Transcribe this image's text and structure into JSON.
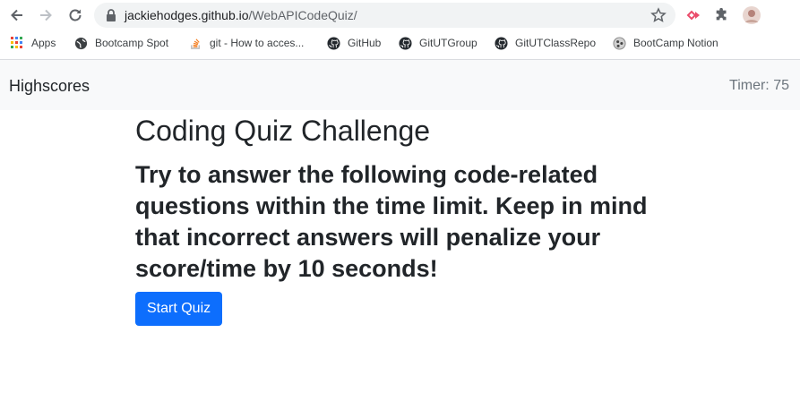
{
  "browser": {
    "url_host": "jackiehodges.github.io",
    "url_path": "/WebAPICodeQuiz/",
    "bookmarks": [
      {
        "label": "Apps",
        "icon": "apps-grid-icon"
      },
      {
        "label": "Bootcamp Spot",
        "icon": "globe-icon"
      },
      {
        "label": "git - How to acces...",
        "icon": "stackoverflow-icon"
      },
      {
        "label": "GitHub",
        "icon": "github-icon"
      },
      {
        "label": "GitUTGroup",
        "icon": "github-icon"
      },
      {
        "label": "GitUTClassRepo",
        "icon": "github-icon"
      },
      {
        "label": "BootCamp Notion",
        "icon": "notion-icon"
      }
    ]
  },
  "header": {
    "highscores_label": "Highscores",
    "timer_text": "Timer: 75"
  },
  "main": {
    "title": "Coding Quiz Challenge",
    "instructions": "Try to answer the following code-related questions within the time limit. Keep in mind that incorrect answers will penalize your score/time by 10 seconds!",
    "start_button_label": "Start Quiz"
  },
  "colors": {
    "primary": "#0d6efd",
    "header_bg": "#f8f9fa",
    "timer_text": "#6c757d"
  }
}
